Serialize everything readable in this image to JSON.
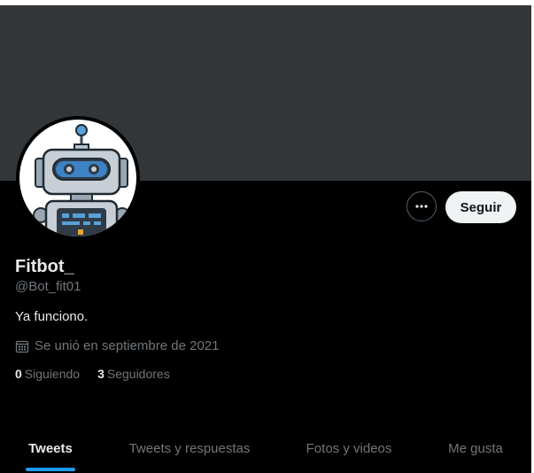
{
  "profile": {
    "name": "Fitbot_",
    "handle": "@Bot_fit01",
    "bio": "Ya funciono.",
    "joined": "Se unió en septiembre de 2021",
    "following_count": "0",
    "following_label": "Siguiendo",
    "followers_count": "3",
    "followers_label": "Seguidores"
  },
  "actions": {
    "more_icon": "more-horizontal-icon",
    "follow_label": "Seguir"
  },
  "tabs": [
    {
      "label": "Tweets",
      "active": true
    },
    {
      "label": "Tweets y respuestas",
      "active": false
    },
    {
      "label": "Fotos y videos",
      "active": false
    },
    {
      "label": "Me gusta",
      "active": false
    }
  ],
  "colors": {
    "background": "#000000",
    "banner": "#333639",
    "accent": "#1d9bf0",
    "text_primary": "#e7e9ea",
    "text_secondary": "#71767b"
  }
}
